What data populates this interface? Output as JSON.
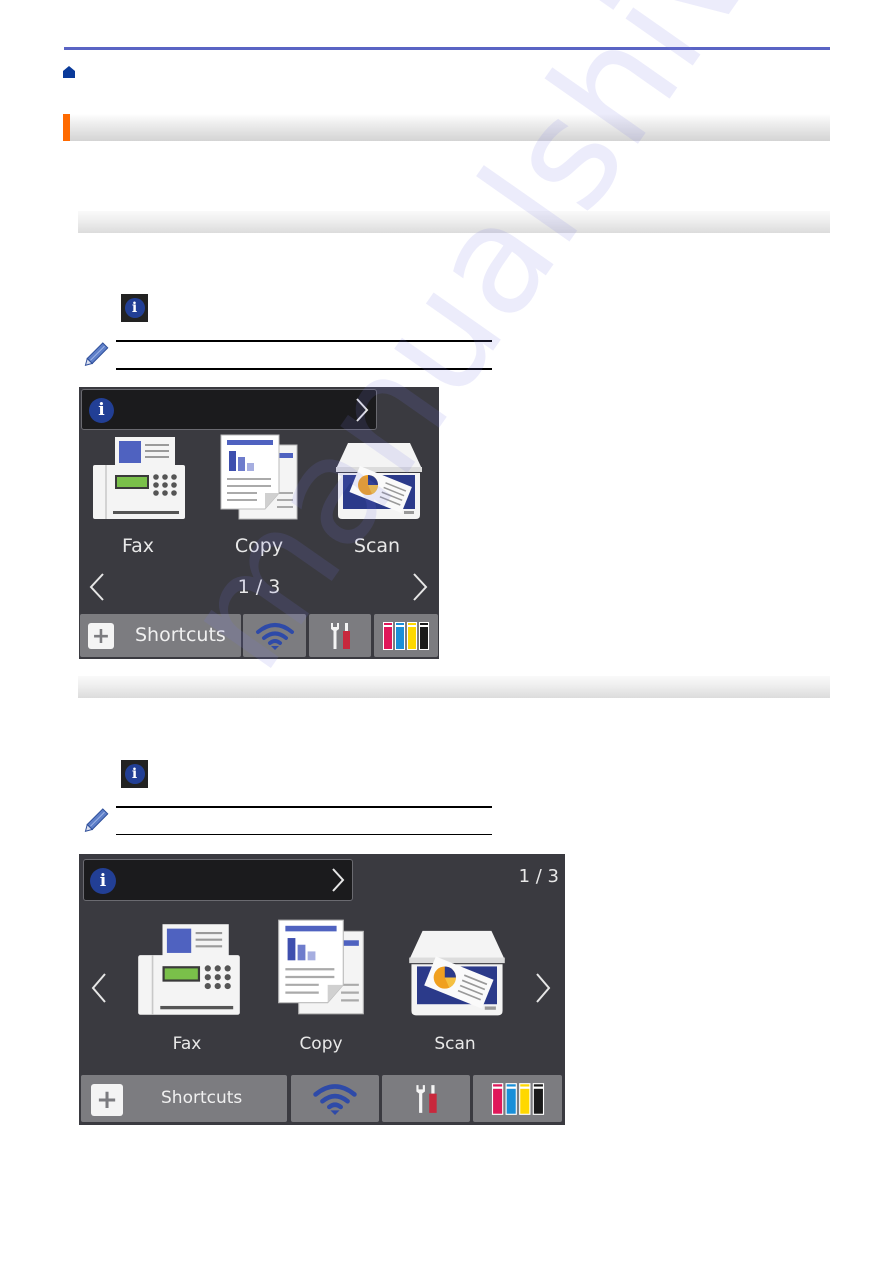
{
  "page": {
    "header": {
      "home_icon": "home-icon",
      "rule_color": "#5a64c4"
    },
    "heading_bar": {
      "accent_color": "#ff6a00",
      "text": ""
    },
    "sections": [
      {
        "subheading": "",
        "step_icon": "info-icon",
        "note_icon": "pencil-icon"
      },
      {
        "subheading": "",
        "step_icon": "info-icon",
        "note_icon": "pencil-icon"
      }
    ],
    "watermark": "manualshive.com"
  },
  "lcd1": {
    "info_icon_label": "i",
    "info_chevron": "chevron-right-icon",
    "apps": [
      {
        "name": "fax",
        "label": "Fax"
      },
      {
        "name": "copy",
        "label": "Copy"
      },
      {
        "name": "scan",
        "label": "Scan"
      }
    ],
    "pager": "1 / 3",
    "shortcuts_label": "Shortcuts",
    "bottom_icons": [
      "plus-icon",
      "wifi-icon",
      "tools-icon",
      "ink-icon"
    ]
  },
  "lcd2": {
    "info_icon_label": "i",
    "info_chevron": "chevron-right-icon",
    "apps": [
      {
        "name": "fax",
        "label": "Fax"
      },
      {
        "name": "copy",
        "label": "Copy"
      },
      {
        "name": "scan",
        "label": "Scan"
      }
    ],
    "pager": "1 / 3",
    "shortcuts_label": "Shortcuts",
    "bottom_icons": [
      "plus-icon",
      "wifi-icon",
      "tools-icon",
      "ink-icon"
    ]
  },
  "colors": {
    "lcd_background": "#3a3a40",
    "info_blue": "#223f95",
    "button_gray": "#7c7c80",
    "wifi_blue": "#2e4aa8",
    "tool_red": "#c8283c",
    "ink_magenta": "#e0185a",
    "ink_cyan": "#1a8fd8",
    "ink_yellow": "#ffd800",
    "ink_black": "#1a1a1a"
  }
}
